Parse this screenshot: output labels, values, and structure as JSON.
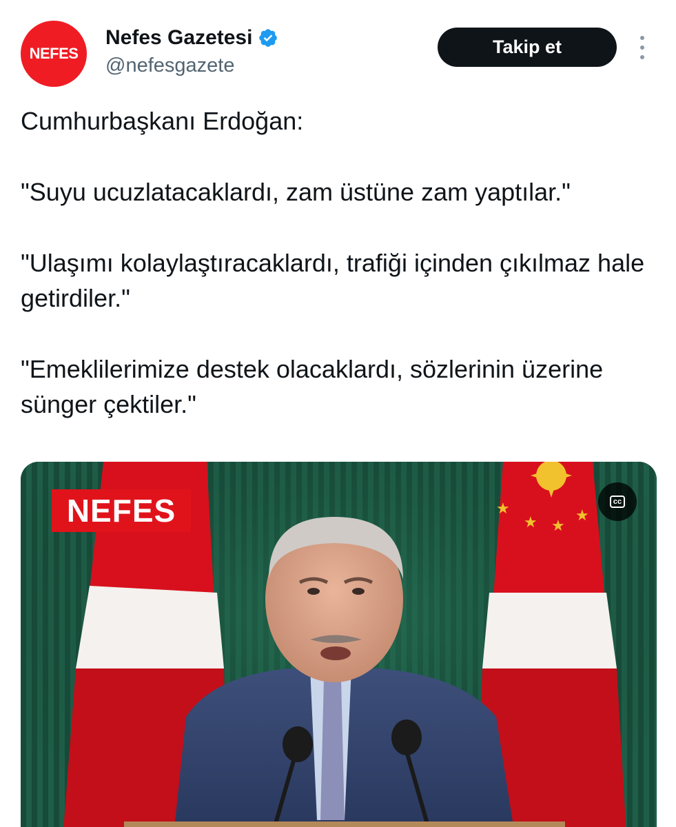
{
  "account": {
    "avatar_text": "NEFES",
    "display_name": "Nefes Gazetesi",
    "handle": "@nefesgazete",
    "verified": true,
    "follow_label": "Takip et",
    "brand_color": "#f01c24"
  },
  "tweet": {
    "lines": [
      "Cumhurbaşkanı Erdoğan:",
      "\"Suyu ucuzlatacaklardı, zam üstüne zam yaptılar.\"",
      "\"Ulaşımı kolaylaştıracaklardı, trafiği içinden çıkılmaz hale getirdiler.\"",
      "\"Emeklilerimize destek olacaklardı, sözlerinin üzerine sünger çektiler.\""
    ]
  },
  "media": {
    "type": "video",
    "watermark": "NEFES",
    "captions_label": "cc",
    "icons": [
      "captions-icon"
    ]
  },
  "icons": [
    "verified-badge-icon",
    "more-options-icon"
  ]
}
